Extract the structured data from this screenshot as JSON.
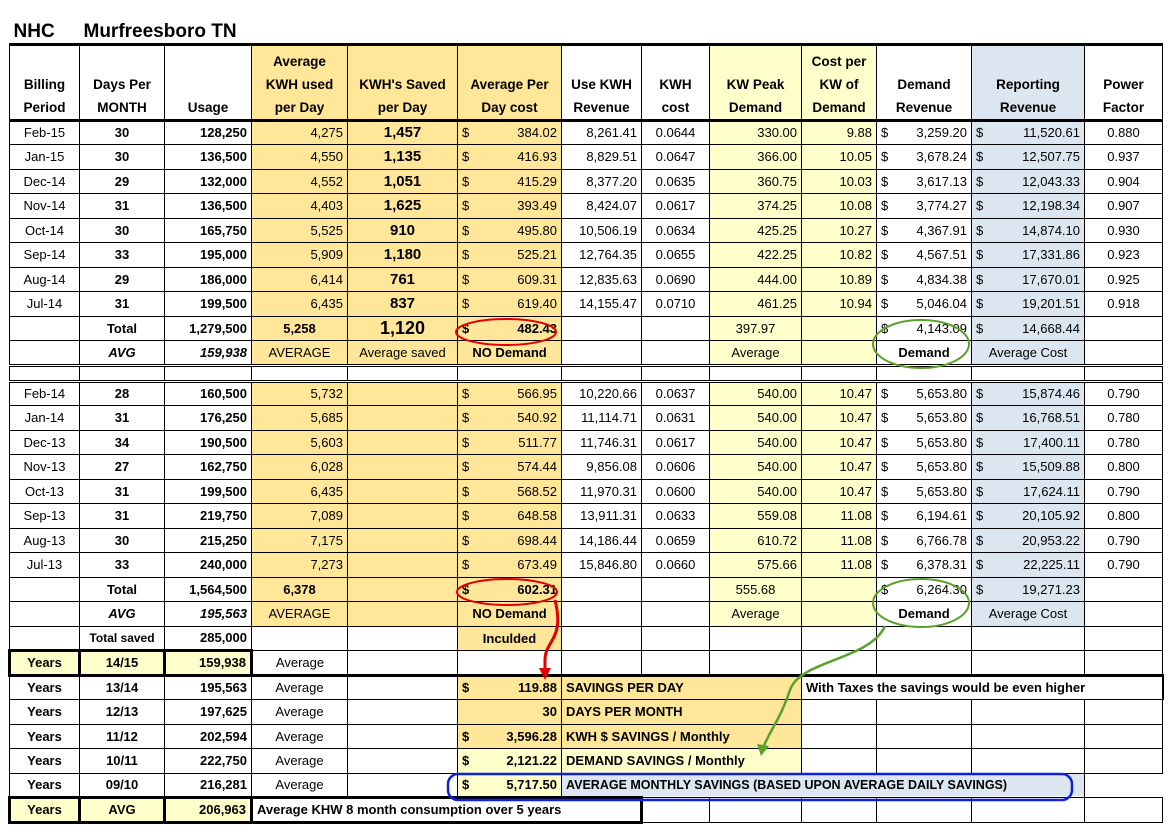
{
  "title": {
    "org": "NHC",
    "location": "Murfreesboro TN"
  },
  "headers": [
    "Billing Period",
    "Days Per MONTH",
    "Usage",
    "Average KWH used per Day",
    "KWH's Saved per Day",
    "Average Per Day cost",
    "Use KWH Revenue",
    "KWH cost",
    "KW Peak Demand",
    "Cost per KW of Demand",
    "Demand Revenue",
    "Reporting Revenue",
    "Power Factor"
  ],
  "currency": "$",
  "recent_rows": [
    [
      "Feb-15",
      "30",
      "128,250",
      "4,275",
      "1,457",
      "384.02",
      "8,261.41",
      "0.0644",
      "330.00",
      "9.88",
      "3,259.20",
      "11,520.61",
      "0.880"
    ],
    [
      "Jan-15",
      "30",
      "136,500",
      "4,550",
      "1,135",
      "416.93",
      "8,829.51",
      "0.0647",
      "366.00",
      "10.05",
      "3,678.24",
      "12,507.75",
      "0.937"
    ],
    [
      "Dec-14",
      "29",
      "132,000",
      "4,552",
      "1,051",
      "415.29",
      "8,377.20",
      "0.0635",
      "360.75",
      "10.03",
      "3,617.13",
      "12,043.33",
      "0.904"
    ],
    [
      "Nov-14",
      "31",
      "136,500",
      "4,403",
      "1,625",
      "393.49",
      "8,424.07",
      "0.0617",
      "374.25",
      "10.08",
      "3,774.27",
      "12,198.34",
      "0.907"
    ],
    [
      "Oct-14",
      "30",
      "165,750",
      "5,525",
      "910",
      "495.80",
      "10,506.19",
      "0.0634",
      "425.25",
      "10.27",
      "4,367.91",
      "14,874.10",
      "0.930"
    ],
    [
      "Sep-14",
      "33",
      "195,000",
      "5,909",
      "1,180",
      "525.21",
      "12,764.35",
      "0.0655",
      "422.25",
      "10.82",
      "4,567.51",
      "17,331.86",
      "0.923"
    ],
    [
      "Aug-14",
      "29",
      "186,000",
      "6,414",
      "761",
      "609.31",
      "12,835.63",
      "0.0690",
      "444.00",
      "10.89",
      "4,834.38",
      "17,670.01",
      "0.925"
    ],
    [
      "Jul-14",
      "31",
      "199,500",
      "6,435",
      "837",
      "619.40",
      "14,155.47",
      "0.0710",
      "461.25",
      "10.94",
      "5,046.04",
      "19,201.51",
      "0.918"
    ]
  ],
  "recent_total": {
    "label": "Total",
    "usage": "1,279,500",
    "avg_kwh": "5,258",
    "saved": "1,120",
    "avg_cost": "482.43",
    "kw_peak": "397.97",
    "demand": "4,143.09",
    "reporting": "14,668.44"
  },
  "recent_avg": {
    "label": "AVG",
    "usage": "159,938",
    "avg_kwh": "AVERAGE",
    "saved": "Average saved",
    "avg_cost": "NO Demand",
    "kw_peak": "Average",
    "demand": "Demand",
    "reporting": "Average Cost"
  },
  "prior_rows": [
    [
      "Feb-14",
      "28",
      "160,500",
      "5,732",
      "",
      "566.95",
      "10,220.66",
      "0.0637",
      "540.00",
      "10.47",
      "5,653.80",
      "15,874.46",
      "0.790"
    ],
    [
      "Jan-14",
      "31",
      "176,250",
      "5,685",
      "",
      "540.92",
      "11,114.71",
      "0.0631",
      "540.00",
      "10.47",
      "5,653.80",
      "16,768.51",
      "0.780"
    ],
    [
      "Dec-13",
      "34",
      "190,500",
      "5,603",
      "",
      "511.77",
      "11,746.31",
      "0.0617",
      "540.00",
      "10.47",
      "5,653.80",
      "17,400.11",
      "0.780"
    ],
    [
      "Nov-13",
      "27",
      "162,750",
      "6,028",
      "",
      "574.44",
      "9,856.08",
      "0.0606",
      "540.00",
      "10.47",
      "5,653.80",
      "15,509.88",
      "0.800"
    ],
    [
      "Oct-13",
      "31",
      "199,500",
      "6,435",
      "",
      "568.52",
      "11,970.31",
      "0.0600",
      "540.00",
      "10.47",
      "5,653.80",
      "17,624.11",
      "0.790"
    ],
    [
      "Sep-13",
      "31",
      "219,750",
      "7,089",
      "",
      "648.58",
      "13,911.31",
      "0.0633",
      "559.08",
      "11.08",
      "6,194.61",
      "20,105.92",
      "0.800"
    ],
    [
      "Aug-13",
      "30",
      "215,250",
      "7,175",
      "",
      "698.44",
      "14,186.44",
      "0.0659",
      "610.72",
      "11.08",
      "6,766.78",
      "20,953.22",
      "0.790"
    ],
    [
      "Jul-13",
      "33",
      "240,000",
      "7,273",
      "",
      "673.49",
      "15,846.80",
      "0.0660",
      "575.66",
      "11.08",
      "6,378.31",
      "22,225.11",
      "0.790"
    ]
  ],
  "prior_total": {
    "label": "Total",
    "usage": "1,564,500",
    "avg_kwh": "6,378",
    "avg_cost": "602.31",
    "kw_peak": "555.68",
    "demand": "6,264.30",
    "reporting": "19,271.23"
  },
  "prior_avg": {
    "label": "AVG",
    "usage": "195,563",
    "avg_kwh": "AVERAGE",
    "avg_cost": "NO Demand",
    "kw_peak": "Average",
    "demand": "Demand",
    "reporting": "Average Cost"
  },
  "total_saved": {
    "label": "Total saved",
    "value": "285,000",
    "note": "Inculded"
  },
  "years": [
    {
      "label": "Years",
      "period": "14/15",
      "value": "159,938",
      "note": "Average"
    },
    {
      "label": "Years",
      "period": "13/14",
      "value": "195,563",
      "note": "Average"
    },
    {
      "label": "Years",
      "period": "12/13",
      "value": "197,625",
      "note": "Average"
    },
    {
      "label": "Years",
      "period": "11/12",
      "value": "202,594",
      "note": "Average"
    },
    {
      "label": "Years",
      "period": "10/11",
      "value": "222,750",
      "note": "Average"
    },
    {
      "label": "Years",
      "period": "09/10",
      "value": "216,281",
      "note": "Average"
    }
  ],
  "years_avg": {
    "label": "Years",
    "period": "AVG",
    "value": "206,963",
    "note": "Average KHW 8 month consumption over 5 years"
  },
  "savings": [
    {
      "cur": "$",
      "value": "119.88",
      "label": "SAVINGS PER DAY"
    },
    {
      "cur": "",
      "value": "30",
      "label": "DAYS PER MONTH"
    },
    {
      "cur": "$",
      "value": "3,596.28",
      "label": "KWH $ SAVINGS / Monthly"
    },
    {
      "cur": "$",
      "value": "2,121.22",
      "label": "DEMAND SAVINGS / Monthly"
    },
    {
      "cur": "$",
      "value": "5,717.50",
      "label": "AVERAGE MONTHLY SAVINGS (BASED UPON AVERAGE DAILY SAVINGS)"
    }
  ],
  "tax_note": "With Taxes the savings would be even higher",
  "colors": {
    "yellow": "#ffe699",
    "light_yellow": "#ffffcc",
    "light_blue": "#dce6f1",
    "red": "#e00000",
    "green": "#5aa02c",
    "blue": "#1020e0"
  }
}
